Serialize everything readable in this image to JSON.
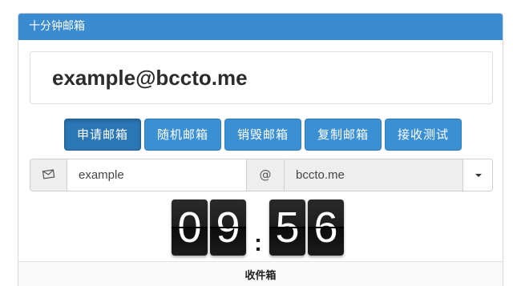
{
  "header": {
    "title": "十分钟邮箱"
  },
  "email": {
    "address": "example@bccto.me"
  },
  "buttons": [
    {
      "label": "申请邮箱",
      "active": true
    },
    {
      "label": "随机邮箱",
      "active": false
    },
    {
      "label": "销毁邮箱",
      "active": false
    },
    {
      "label": "复制邮箱",
      "active": false
    },
    {
      "label": "接收测试",
      "active": false
    }
  ],
  "form": {
    "username": "example",
    "at_symbol": "@",
    "domain": "bccto.me"
  },
  "timer": {
    "d1": "0",
    "d2": "9",
    "colon": ":",
    "d3": "5",
    "d4": "6"
  },
  "inbox": {
    "label": "收件箱"
  },
  "colors": {
    "accent": "#3b8fd3",
    "header": "#3b8bd0"
  }
}
